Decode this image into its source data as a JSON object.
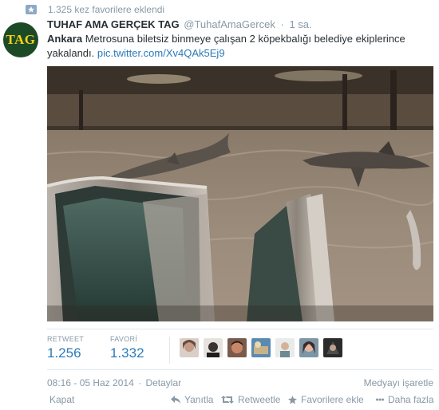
{
  "context": {
    "text": "1.325 kez favorilere eklendi"
  },
  "tweet": {
    "avatar_text": "TAG",
    "fullname": "TUHAF AMA GERÇEK TAG",
    "username": "@TuhafAmaGercek",
    "separator": "·",
    "time": "1 sa.",
    "text_bold": "Ankara",
    "text_body": " Metrosuna biletsiz binmeye çalışan 2 köpekbalığı belediye ekiplerince yakalandı. ",
    "link": "pic.twitter.com/Xv4QAk5Ej9"
  },
  "stats": {
    "retweet_label": "RETWEET",
    "retweet_count": "1.256",
    "favorite_label": "FAVORİ",
    "favorite_count": "1.332"
  },
  "meta": {
    "datetime": "08:16 - 05 Haz 2014",
    "separator": "·",
    "details": "Detaylar",
    "report_media": "Medyayı işaretle"
  },
  "actions": {
    "collapse": "Kapat",
    "reply": "Yanıtla",
    "retweet": "Retweetle",
    "favorite": "Favorilere ekle",
    "more": "Daha fazla"
  },
  "colors": {
    "link": "#2b7bb9",
    "muted": "#8899a6",
    "text": "#292f33",
    "border": "#e1e8ed"
  },
  "icons": [
    "star-icon",
    "reply-icon",
    "retweet-icon",
    "star-icon",
    "more-icon",
    "collapse-icon"
  ]
}
